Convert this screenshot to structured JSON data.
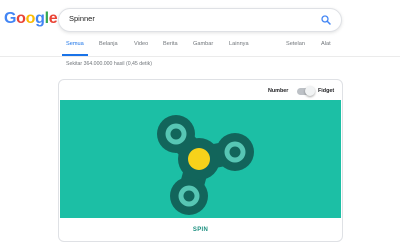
{
  "logo": {
    "letters": [
      "G",
      "o",
      "o",
      "g",
      "l",
      "e"
    ],
    "colors": [
      "#4285f4",
      "#ea4335",
      "#fbbc05",
      "#4285f4",
      "#34a853",
      "#ea4335"
    ]
  },
  "search": {
    "query": "Spinner",
    "icon": "search-icon"
  },
  "tabs": [
    "Semua",
    "Belanja",
    "Video",
    "Berita",
    "Gambar",
    "Lainnya"
  ],
  "tools": {
    "settings": "Setelan",
    "tools": "Alat"
  },
  "results_stats": "Sekitar 364.000.000 hasil (0,45 detik)",
  "spinner_widget": {
    "mode_left": "Number",
    "mode_right": "Fidget",
    "toggle_on": true,
    "button": "SPIN",
    "colors": {
      "background": "#1cbfa5",
      "body": "#12655b",
      "ring": "#57c6b4",
      "center": "#f7d21a"
    }
  }
}
